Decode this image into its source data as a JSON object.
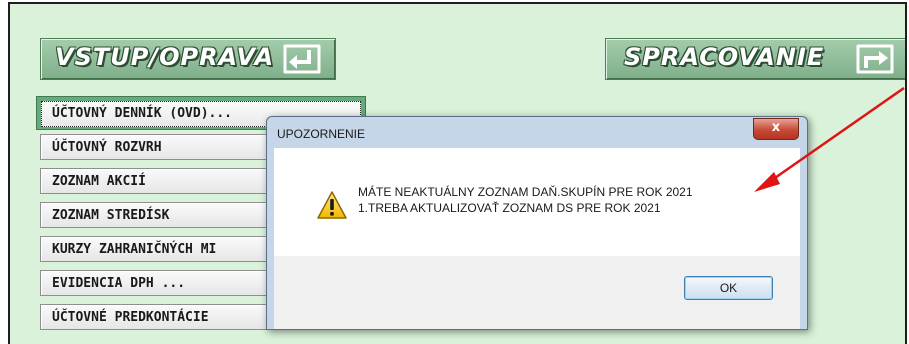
{
  "header": {
    "vstup_label": "VSTUP/OPRAVA",
    "spracovanie_label": "SPRACOVANIE"
  },
  "menu": {
    "items": [
      {
        "label": "ÚČTOVNÝ DENNÍK (OVD)..."
      },
      {
        "label": "ÚČTOVNÝ ROZVRH"
      },
      {
        "label": "ZOZNAM AKCIÍ"
      },
      {
        "label": "ZOZNAM STREDÍSK"
      },
      {
        "label": "KURZY ZAHRANIČNÝCH MI"
      },
      {
        "label": "EVIDENCIA DPH ..."
      },
      {
        "label": "ÚČTOVNÉ PREDKONTÁCIE"
      }
    ]
  },
  "dialog": {
    "title": "UPOZORNENIE",
    "close_label": "x",
    "line1": "MÁTE NEAKTUÁLNY ZOZNAM DAŇ.SKUPÍN PRE ROK 2021",
    "line2": "1.TREBA AKTUALIZOVAŤ ZOZNAM DS PRE ROK 2021",
    "ok_label": "OK"
  },
  "colors": {
    "background": "#d9f2d9",
    "header_button": "#8fbf9a",
    "annotation_arrow": "#e01414"
  },
  "icons": {
    "vstup": "return-arrow-icon",
    "spracovanie": "forward-arrow-icon",
    "warning": "warning-icon"
  }
}
